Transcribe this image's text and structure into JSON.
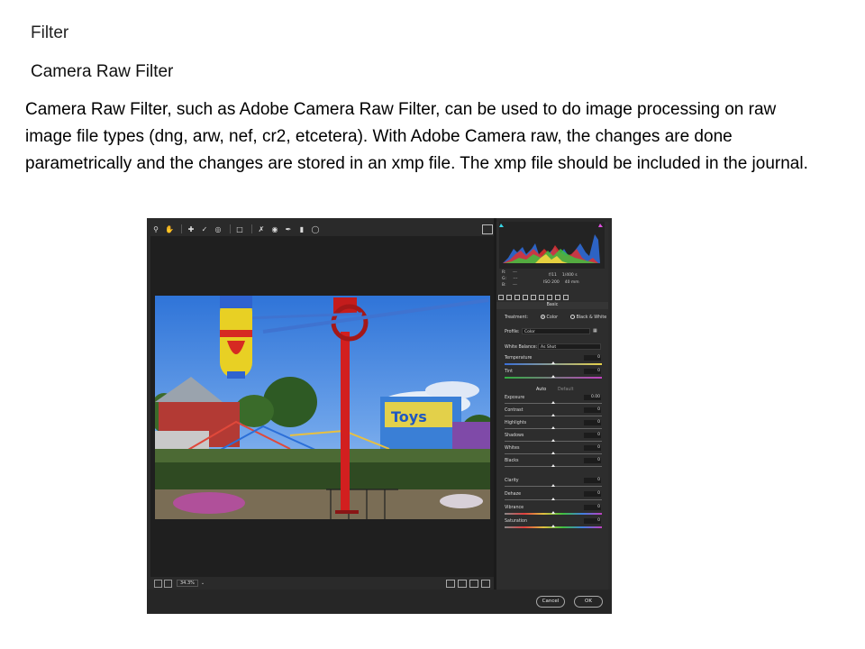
{
  "slide": {
    "heading": "Filter",
    "subheading": "Camera Raw Filter",
    "body": "Camera Raw Filter, such as Adobe Camera Raw Filter, can be used to do image processing on raw image file types (dng, arw, nef, cr2, etcetera). With Adobe Camera raw, the changes are done parametrically and the changes are stored in an xmp file. The xmp file should be included in the journal."
  },
  "camera_raw": {
    "readout": {
      "r_label": "R:",
      "g_label": "G:",
      "b_label": "B:",
      "r_value": "---",
      "g_value": "---",
      "b_value": "---",
      "aperture": "f/11",
      "shutter": "1/400 s",
      "iso": "ISO 200",
      "focal": "40 mm"
    },
    "panel_title": "Basic",
    "treatment": {
      "label": "Treatment:",
      "color": "Color",
      "bw": "Black & White"
    },
    "profile": {
      "label": "Profile:",
      "value": "Color"
    },
    "white_balance": {
      "label": "White Balance:",
      "value": "As Shot"
    },
    "temperature": {
      "label": "Temperature",
      "value": "0"
    },
    "tint": {
      "label": "Tint",
      "value": "0"
    },
    "auto_label": "Auto",
    "default_label": "Default",
    "tone": [
      {
        "label": "Exposure",
        "value": "0.00"
      },
      {
        "label": "Contrast",
        "value": "0"
      },
      {
        "label": "Highlights",
        "value": "0"
      },
      {
        "label": "Shadows",
        "value": "0"
      },
      {
        "label": "Whites",
        "value": "0"
      },
      {
        "label": "Blacks",
        "value": "0"
      }
    ],
    "presence": [
      {
        "label": "Clarity",
        "value": "0"
      },
      {
        "label": "Dehaze",
        "value": "0"
      },
      {
        "label": "Vibrance",
        "value": "0"
      },
      {
        "label": "Saturation",
        "value": "0"
      }
    ],
    "zoom": "34.3%",
    "cancel_label": "Cancel",
    "ok_label": "OK"
  }
}
